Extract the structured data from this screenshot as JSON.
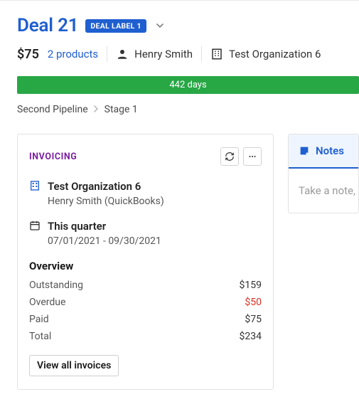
{
  "header": {
    "deal_title": "Deal 21",
    "deal_label": "DEAL LABEL 1"
  },
  "meta": {
    "amount": "$75",
    "products_text": "2 products",
    "person_name": "Henry Smith",
    "org_name": "Test Organization 6"
  },
  "days_bar": "442 days",
  "breadcrumb": {
    "pipeline": "Second Pipeline",
    "stage": "Stage 1"
  },
  "invoicing": {
    "title": "INVOICING",
    "org_name": "Test Organization 6",
    "person_line": "Henry Smith (QuickBooks)",
    "period_label": "This quarter",
    "period_range": "07/01/2021 - 09/30/2021",
    "overview_label": "Overview",
    "rows": {
      "outstanding": {
        "label": "Outstanding",
        "value": "$159"
      },
      "overdue": {
        "label": "Overdue",
        "value": "$50"
      },
      "paid": {
        "label": "Paid",
        "value": "$75"
      },
      "total": {
        "label": "Total",
        "value": "$234"
      }
    },
    "view_all_label": "View all invoices"
  },
  "notes": {
    "tab_label": "Notes",
    "placeholder": "Take a note, @"
  }
}
